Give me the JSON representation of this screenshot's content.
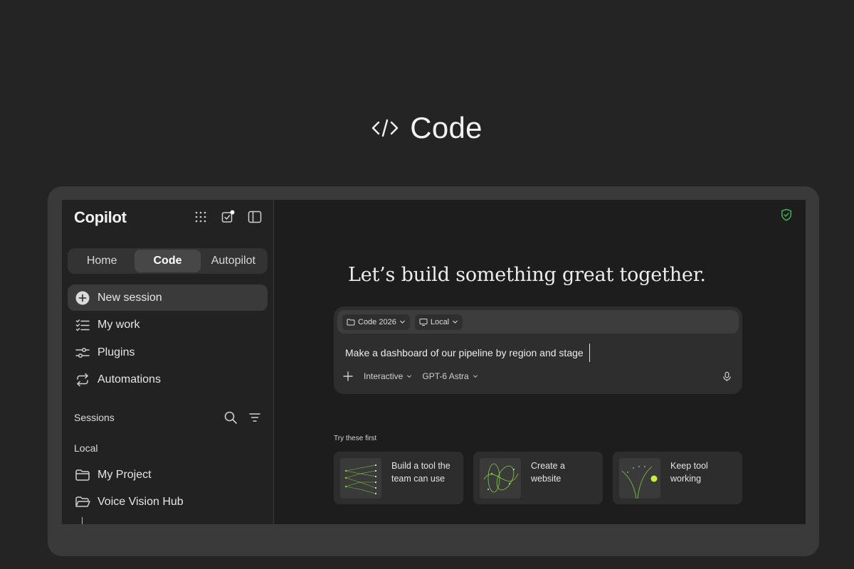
{
  "hero": {
    "title": "Code"
  },
  "app": {
    "brand": "Copilot",
    "tabs": [
      {
        "label": "Home"
      },
      {
        "label": "Code"
      },
      {
        "label": "Autopilot"
      }
    ],
    "nav": [
      {
        "label": "New session",
        "icon": "plus-circle-icon"
      },
      {
        "label": "My work",
        "icon": "checklist-icon"
      },
      {
        "label": "Plugins",
        "icon": "sliders-icon"
      },
      {
        "label": "Automations",
        "icon": "repeat-icon"
      }
    ],
    "sessions_label": "Sessions",
    "local_label": "Local",
    "projects": [
      {
        "label": "My Project",
        "icon": "folder-icon"
      },
      {
        "label": "Voice Vision Hub",
        "icon": "folder-open-icon"
      }
    ]
  },
  "main": {
    "headline": "Let’s build something great together.",
    "composer": {
      "chip_folder": "Code 2026",
      "chip_env": "Local",
      "prompt": "Make a dashboard of our pipeline by region and stage",
      "mode": "Interactive",
      "model": "GPT-6 Astra"
    },
    "try_label": "Try these first",
    "cards": [
      {
        "text": "Build a tool the team can use"
      },
      {
        "text": "Create a website"
      },
      {
        "text": "Keep tool working"
      }
    ]
  },
  "colors": {
    "accent": "#7fd13b",
    "bg": "#242424",
    "screen": "#1d1d1d",
    "shield": "#3fb950"
  }
}
